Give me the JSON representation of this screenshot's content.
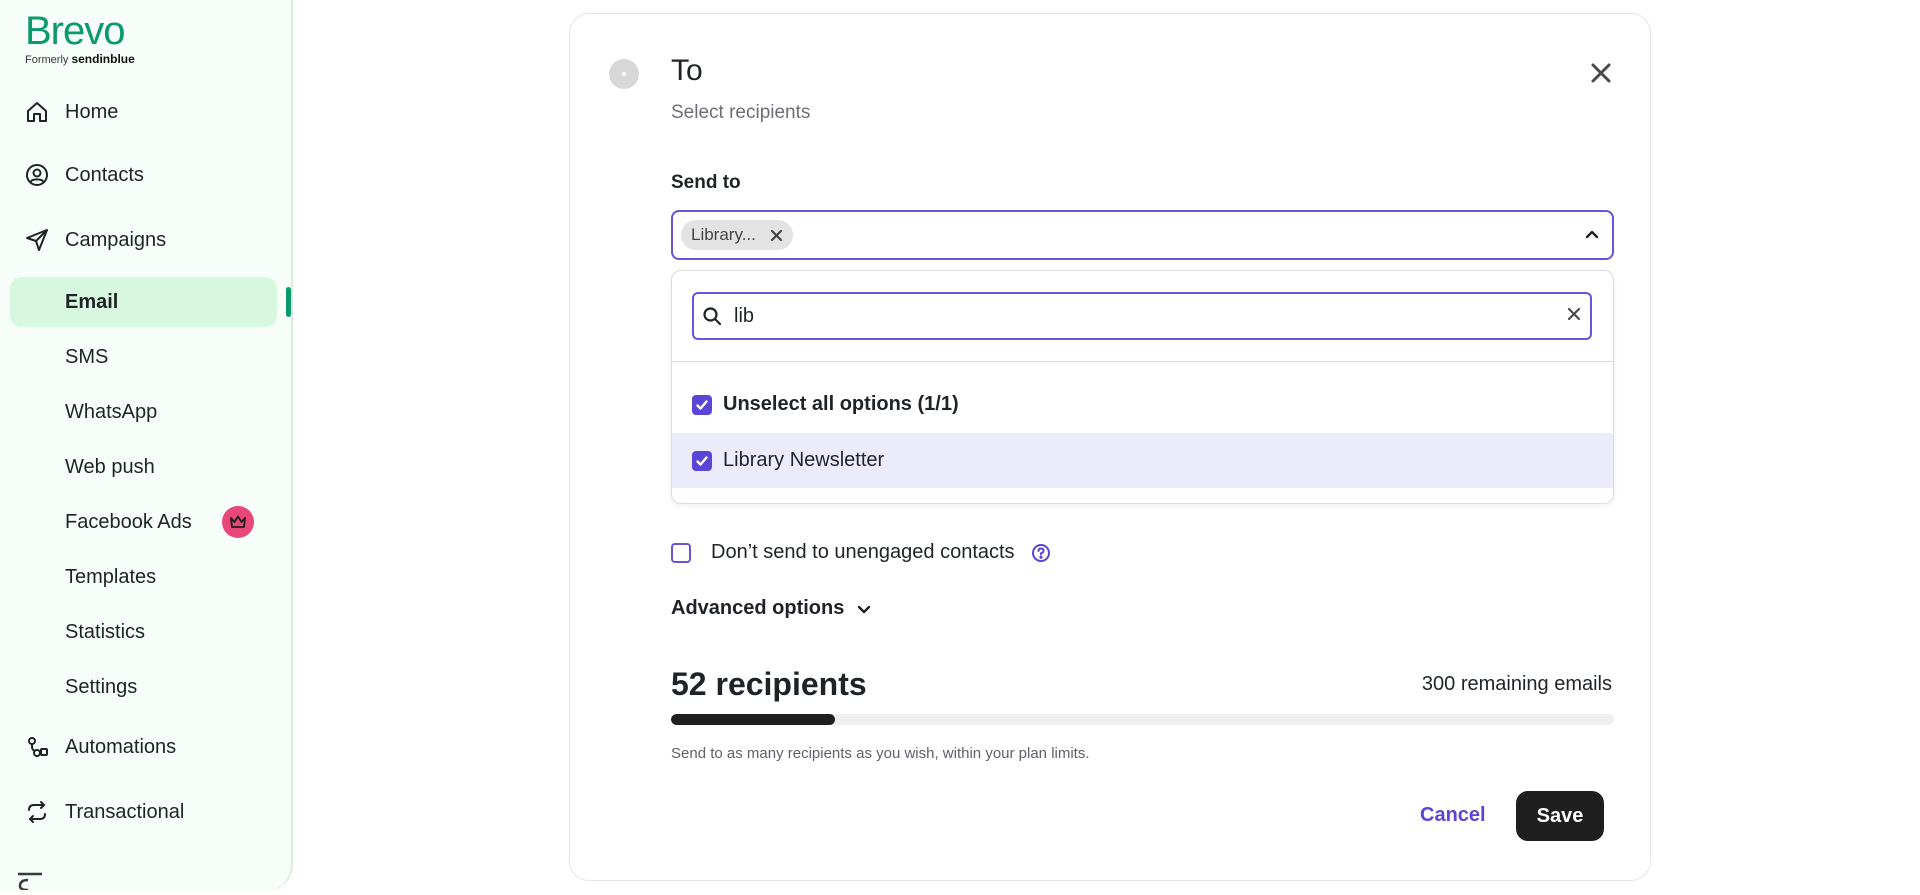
{
  "brand": {
    "name": "Brevo",
    "formerly_label": "Formerly",
    "formerly_name": "sendinblue",
    "accent": "#0b996e"
  },
  "sidebar": {
    "items": [
      {
        "label": "Home",
        "icon": "home-icon"
      },
      {
        "label": "Contacts",
        "icon": "contacts-icon"
      },
      {
        "label": "Campaigns",
        "icon": "send-icon"
      }
    ],
    "sub_items": [
      {
        "label": "Email",
        "active": true
      },
      {
        "label": "SMS"
      },
      {
        "label": "WhatsApp"
      },
      {
        "label": "Web push"
      },
      {
        "label": "Facebook Ads",
        "badge": "crown-icon"
      },
      {
        "label": "Templates"
      },
      {
        "label": "Statistics"
      },
      {
        "label": "Settings"
      }
    ],
    "bottom_items": [
      {
        "label": "Automations",
        "icon": "automation-icon"
      },
      {
        "label": "Transactional",
        "icon": "transactional-icon"
      }
    ]
  },
  "modal": {
    "title": "To",
    "subtitle": "Select recipients",
    "send_to_label": "Send to",
    "selected_chip": "Library...",
    "search_value": "lib",
    "options": [
      {
        "label": "Unselect all options (1/1)",
        "checked": true,
        "bold": true
      },
      {
        "label": "Library Newsletter",
        "checked": true,
        "highlighted": true
      }
    ],
    "unengaged_label": "Don’t send to unengaged contacts",
    "unengaged_checked": false,
    "advanced_label": "Advanced options",
    "recipients": "52 recipients",
    "remaining": "300 remaining emails",
    "progress_fraction": 0.174,
    "note": "Send to as many recipients as you wish, within your plan limits.",
    "cancel_label": "Cancel",
    "save_label": "Save"
  },
  "colors": {
    "primary": "#5b45d6",
    "active_bg": "#d7f8df",
    "badge": "#e8477a"
  }
}
